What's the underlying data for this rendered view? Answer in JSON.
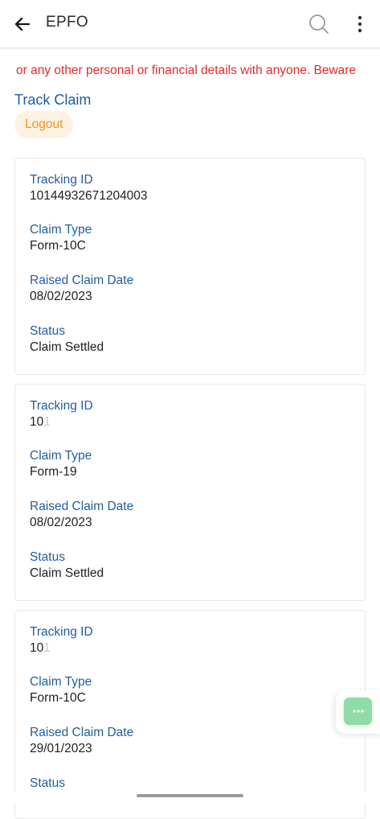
{
  "appbar": {
    "title": "EPFO",
    "back_icon": "arrow-left-icon",
    "search_icon": "search-icon",
    "more_icon": "more-vertical-icon"
  },
  "notice": {
    "text": "or any other personal or financial details with anyone. Beware",
    "color": "#e22b2b"
  },
  "page": {
    "title": "Track Claim",
    "logout_label": "Logout"
  },
  "labels": {
    "tracking_id": "Tracking ID",
    "claim_type": "Claim Type",
    "raised_date": "Raised Claim Date",
    "status": "Status"
  },
  "claims": [
    {
      "tracking_id": "10144932671204003",
      "claim_type": "Form-10C",
      "raised_date": "08/02/2023",
      "status": "Claim Settled"
    },
    {
      "tracking_id_visible": "10",
      "tracking_id_faded": "1",
      "claim_type": "Form-19",
      "raised_date": "08/02/2023",
      "status": "Claim Settled"
    },
    {
      "tracking_id_visible": "10",
      "tracking_id_faded": "1",
      "claim_type": "Form-10C",
      "raised_date": "29/01/2023",
      "status": ""
    }
  ],
  "colors": {
    "accent": "#1f5e9c",
    "logout_text": "#f0941d",
    "logout_bg": "#fdf1e2",
    "chat_fab": "#8fdca6"
  },
  "chat_icon": "chat-dots-icon"
}
